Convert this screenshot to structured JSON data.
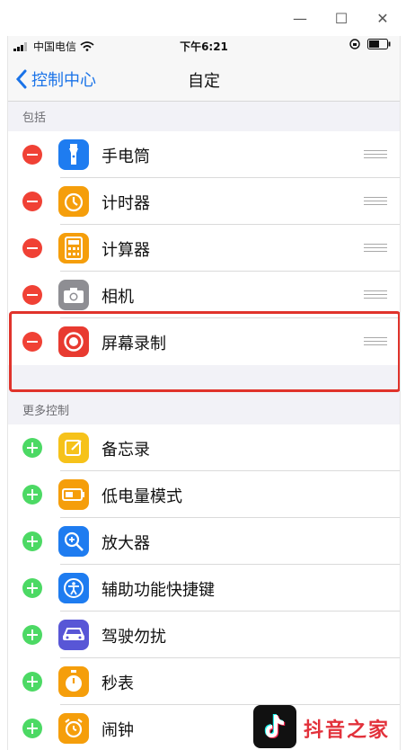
{
  "window": {
    "controls": [
      "—",
      "☐",
      "✕"
    ]
  },
  "status": {
    "carrier": "中国电信",
    "time": "下午6:21"
  },
  "nav": {
    "back_label": "控制中心",
    "title": "自定"
  },
  "sections": {
    "included": "包括",
    "more": "更多控制"
  },
  "included_items": [
    {
      "label": "手电筒",
      "icon": "flashlight-icon",
      "color": "#1e7cf0"
    },
    {
      "label": "计时器",
      "icon": "timer-icon",
      "color": "#f59e0b"
    },
    {
      "label": "计算器",
      "icon": "calculator-icon",
      "color": "#f59e0b"
    },
    {
      "label": "相机",
      "icon": "camera-icon",
      "color": "#8e8e93"
    },
    {
      "label": "屏幕录制",
      "icon": "screen-record-icon",
      "color": "#e83a30"
    }
  ],
  "more_items": [
    {
      "label": "备忘录",
      "icon": "notes-icon",
      "color": "#f6c21a"
    },
    {
      "label": "低电量模式",
      "icon": "battery-icon",
      "color": "#f59e0b"
    },
    {
      "label": "放大器",
      "icon": "magnifier-icon",
      "color": "#1e7cf0"
    },
    {
      "label": "辅助功能快捷键",
      "icon": "accessibility-icon",
      "color": "#1e7cf0"
    },
    {
      "label": "驾驶勿扰",
      "icon": "car-icon",
      "color": "#5856d6"
    },
    {
      "label": "秒表",
      "icon": "stopwatch-icon",
      "color": "#f59e0b"
    },
    {
      "label": "闹钟",
      "icon": "alarm-icon",
      "color": "#f59e0b"
    }
  ],
  "watermark": {
    "text": "抖音之家"
  }
}
